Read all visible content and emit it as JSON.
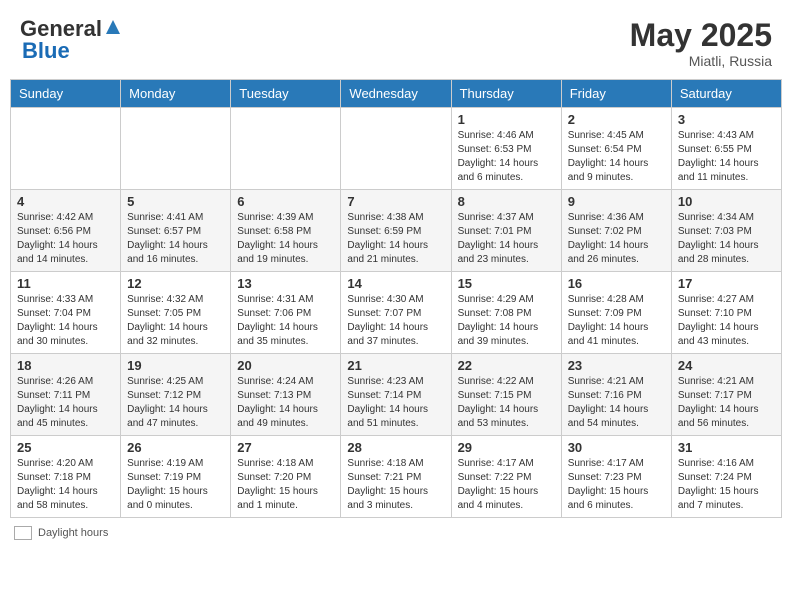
{
  "header": {
    "logo_general": "General",
    "logo_blue": "Blue",
    "month_year": "May 2025",
    "location": "Miatli, Russia"
  },
  "footer": {
    "label": "Daylight hours"
  },
  "days_of_week": [
    "Sunday",
    "Monday",
    "Tuesday",
    "Wednesday",
    "Thursday",
    "Friday",
    "Saturday"
  ],
  "weeks": [
    [
      {
        "num": "",
        "info": ""
      },
      {
        "num": "",
        "info": ""
      },
      {
        "num": "",
        "info": ""
      },
      {
        "num": "",
        "info": ""
      },
      {
        "num": "1",
        "info": "Sunrise: 4:46 AM\nSunset: 6:53 PM\nDaylight: 14 hours\nand 6 minutes."
      },
      {
        "num": "2",
        "info": "Sunrise: 4:45 AM\nSunset: 6:54 PM\nDaylight: 14 hours\nand 9 minutes."
      },
      {
        "num": "3",
        "info": "Sunrise: 4:43 AM\nSunset: 6:55 PM\nDaylight: 14 hours\nand 11 minutes."
      }
    ],
    [
      {
        "num": "4",
        "info": "Sunrise: 4:42 AM\nSunset: 6:56 PM\nDaylight: 14 hours\nand 14 minutes."
      },
      {
        "num": "5",
        "info": "Sunrise: 4:41 AM\nSunset: 6:57 PM\nDaylight: 14 hours\nand 16 minutes."
      },
      {
        "num": "6",
        "info": "Sunrise: 4:39 AM\nSunset: 6:58 PM\nDaylight: 14 hours\nand 19 minutes."
      },
      {
        "num": "7",
        "info": "Sunrise: 4:38 AM\nSunset: 6:59 PM\nDaylight: 14 hours\nand 21 minutes."
      },
      {
        "num": "8",
        "info": "Sunrise: 4:37 AM\nSunset: 7:01 PM\nDaylight: 14 hours\nand 23 minutes."
      },
      {
        "num": "9",
        "info": "Sunrise: 4:36 AM\nSunset: 7:02 PM\nDaylight: 14 hours\nand 26 minutes."
      },
      {
        "num": "10",
        "info": "Sunrise: 4:34 AM\nSunset: 7:03 PM\nDaylight: 14 hours\nand 28 minutes."
      }
    ],
    [
      {
        "num": "11",
        "info": "Sunrise: 4:33 AM\nSunset: 7:04 PM\nDaylight: 14 hours\nand 30 minutes."
      },
      {
        "num": "12",
        "info": "Sunrise: 4:32 AM\nSunset: 7:05 PM\nDaylight: 14 hours\nand 32 minutes."
      },
      {
        "num": "13",
        "info": "Sunrise: 4:31 AM\nSunset: 7:06 PM\nDaylight: 14 hours\nand 35 minutes."
      },
      {
        "num": "14",
        "info": "Sunrise: 4:30 AM\nSunset: 7:07 PM\nDaylight: 14 hours\nand 37 minutes."
      },
      {
        "num": "15",
        "info": "Sunrise: 4:29 AM\nSunset: 7:08 PM\nDaylight: 14 hours\nand 39 minutes."
      },
      {
        "num": "16",
        "info": "Sunrise: 4:28 AM\nSunset: 7:09 PM\nDaylight: 14 hours\nand 41 minutes."
      },
      {
        "num": "17",
        "info": "Sunrise: 4:27 AM\nSunset: 7:10 PM\nDaylight: 14 hours\nand 43 minutes."
      }
    ],
    [
      {
        "num": "18",
        "info": "Sunrise: 4:26 AM\nSunset: 7:11 PM\nDaylight: 14 hours\nand 45 minutes."
      },
      {
        "num": "19",
        "info": "Sunrise: 4:25 AM\nSunset: 7:12 PM\nDaylight: 14 hours\nand 47 minutes."
      },
      {
        "num": "20",
        "info": "Sunrise: 4:24 AM\nSunset: 7:13 PM\nDaylight: 14 hours\nand 49 minutes."
      },
      {
        "num": "21",
        "info": "Sunrise: 4:23 AM\nSunset: 7:14 PM\nDaylight: 14 hours\nand 51 minutes."
      },
      {
        "num": "22",
        "info": "Sunrise: 4:22 AM\nSunset: 7:15 PM\nDaylight: 14 hours\nand 53 minutes."
      },
      {
        "num": "23",
        "info": "Sunrise: 4:21 AM\nSunset: 7:16 PM\nDaylight: 14 hours\nand 54 minutes."
      },
      {
        "num": "24",
        "info": "Sunrise: 4:21 AM\nSunset: 7:17 PM\nDaylight: 14 hours\nand 56 minutes."
      }
    ],
    [
      {
        "num": "25",
        "info": "Sunrise: 4:20 AM\nSunset: 7:18 PM\nDaylight: 14 hours\nand 58 minutes."
      },
      {
        "num": "26",
        "info": "Sunrise: 4:19 AM\nSunset: 7:19 PM\nDaylight: 15 hours\nand 0 minutes."
      },
      {
        "num": "27",
        "info": "Sunrise: 4:18 AM\nSunset: 7:20 PM\nDaylight: 15 hours\nand 1 minute."
      },
      {
        "num": "28",
        "info": "Sunrise: 4:18 AM\nSunset: 7:21 PM\nDaylight: 15 hours\nand 3 minutes."
      },
      {
        "num": "29",
        "info": "Sunrise: 4:17 AM\nSunset: 7:22 PM\nDaylight: 15 hours\nand 4 minutes."
      },
      {
        "num": "30",
        "info": "Sunrise: 4:17 AM\nSunset: 7:23 PM\nDaylight: 15 hours\nand 6 minutes."
      },
      {
        "num": "31",
        "info": "Sunrise: 4:16 AM\nSunset: 7:24 PM\nDaylight: 15 hours\nand 7 minutes."
      }
    ]
  ]
}
